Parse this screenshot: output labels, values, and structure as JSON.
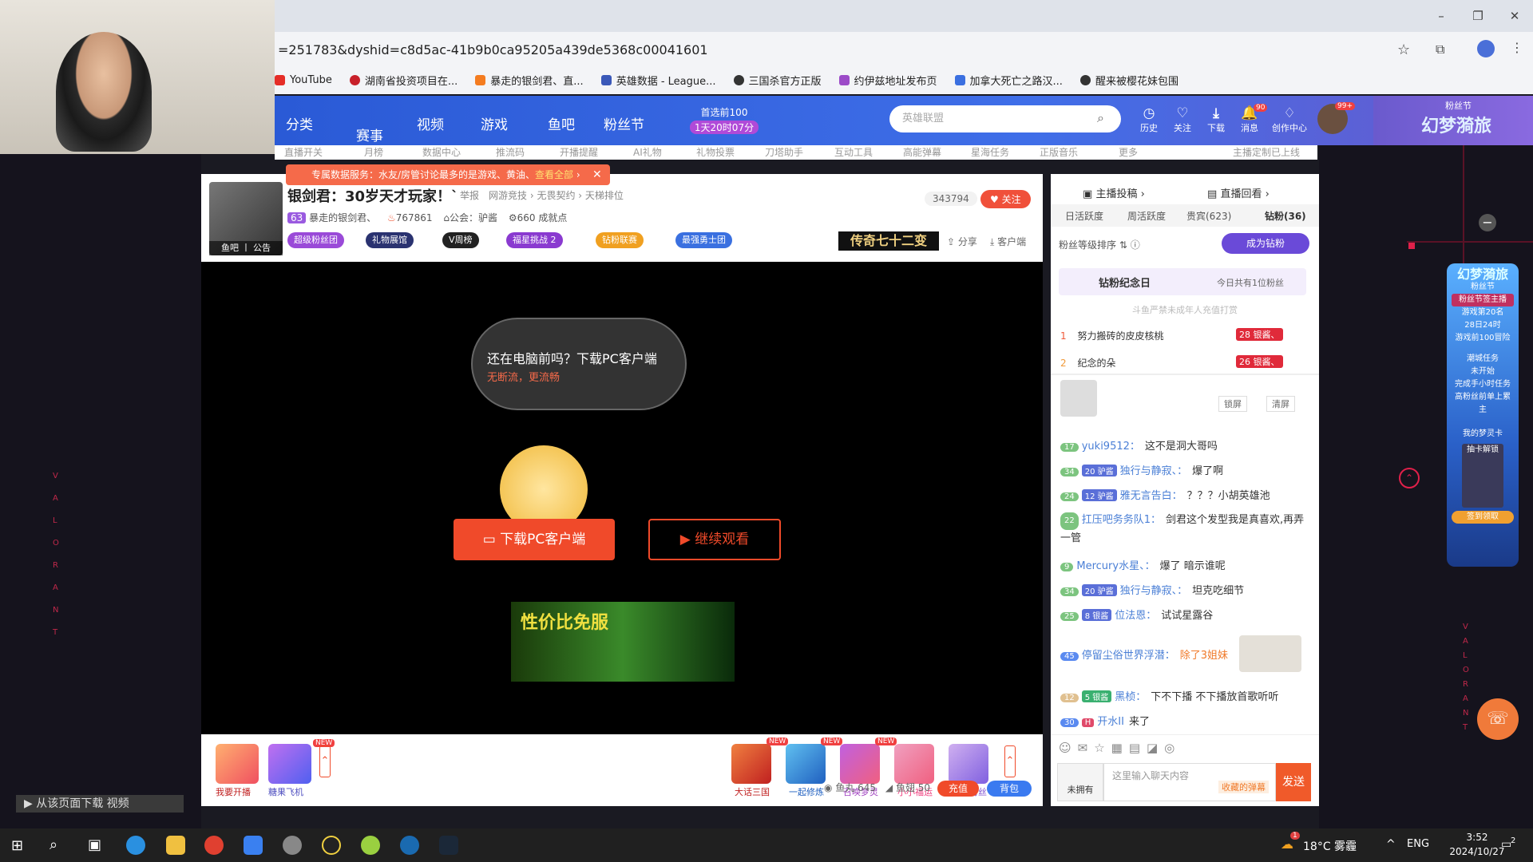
{
  "browser": {
    "url": "=251783&dyshid=c8d5ac-41b9b0ca95205a439de5368c00041601",
    "bookmarks": [
      "YouTube",
      "湖南省投资项目在...",
      "暴走的银剑君、直...",
      "英雄数据 - League...",
      "三国杀官方正版",
      "约伊兹地址发布页",
      "加拿大死亡之路汉...",
      "醒来被樱花妹包围"
    ]
  },
  "site": {
    "nav": [
      "分类",
      "赛事",
      "视频",
      "游戏",
      "鱼吧",
      "粉丝节"
    ],
    "promo_top": "首选前100",
    "promo_timer": "1天20时07分",
    "search_placeholder": "英雄联盟",
    "header_icons": [
      "历史",
      "关注",
      "下载",
      "消息",
      "创作中心"
    ],
    "msg_count": "90",
    "avatar_badge": "99+",
    "banner_text": "幻梦漪旅",
    "banner_sub": "粉丝节",
    "subnav": [
      "直播开关",
      "月榜",
      "数据中心",
      "推流码",
      "开播提醒",
      "AI礼物",
      "礼物投票",
      "刀塔助手",
      "互动工具",
      "高能弹幕",
      "星海任务",
      "正版音乐",
      "更多",
      "主播定制已上线"
    ]
  },
  "notice": {
    "text": "专属数据服务：水友/房管讨论最多的是游戏、黄油、",
    "link": "查看全部"
  },
  "room": {
    "title": "银剑君：30岁天才玩家！`",
    "report": "举报",
    "category": "网游竞技",
    "category2": "无畏契约",
    "category3": "天梯排位",
    "level": "63",
    "streamer": "暴走的银剑君、",
    "hot": "767861",
    "guild": "公会：驴酱",
    "achieve": "660 成就点",
    "followers": "343794",
    "follow": "关注",
    "share": "分享",
    "client": "客户端",
    "avatar_label": "鱼吧 丨 公告",
    "badges": [
      "超级粉丝团",
      "礼物展馆",
      "V周榜",
      "福星挑战 2",
      "钻粉联赛",
      "最强勇士团"
    ],
    "ad_title": "传奇七十二变"
  },
  "player": {
    "bubble_line1": "还在电脑前吗？下载PC客户端",
    "bubble_line2": "无断流，更流畅",
    "download_btn": "下载PC客户端",
    "continue_btn": "继续观看",
    "ad_text": "性价比免服"
  },
  "giftbar": {
    "left": [
      "我要开播",
      "糖果飞机"
    ],
    "right": [
      "大话三国",
      "一起修炼",
      "召唤梦灵",
      "小小福运",
      "钻石粉丝"
    ],
    "fish_ball": "鱼丸 645",
    "fish_fin": "鱼翅 50",
    "recharge": "充值",
    "bag": "背包",
    "new_tag": "NEW"
  },
  "rpanel": {
    "top_links": [
      "主播投稿",
      "直播回看"
    ],
    "tabs": [
      "日活跃度",
      "周活跃度",
      "贵宾(623)",
      "钻粉(36)"
    ],
    "sort_label": "粉丝等级排序",
    "become_btn": "成为钻粉",
    "anniv_title": "钻粉纪念日",
    "anniv_sub": "今日共有1位粉丝",
    "minor_notice": "斗鱼严禁未成年人充值打赏",
    "ranks": [
      {
        "no": "1",
        "name": "努力搬砖的皮皮核桃",
        "lv": "28",
        "tag": "银酱、"
      },
      {
        "no": "2",
        "name": "纪念的朵",
        "lv": "26",
        "tag": "银酱、"
      }
    ],
    "lock": "锁屏",
    "clear": "清屏",
    "chats": [
      {
        "lv": "17",
        "fan": "",
        "name": "yuki9512：",
        "msg": "这不是洞大哥吗"
      },
      {
        "lv": "34",
        "fan": "20 驴酱",
        "name": "独行与静寂、：",
        "msg": "爆了啊"
      },
      {
        "lv": "24",
        "fan": "12 驴酱",
        "name": "雅无言告白：",
        "msg": "？？？小胡英雄池"
      },
      {
        "lv": "22",
        "fan": "",
        "name": "扛压吧务务队1：",
        "msg": "剑君这个发型我是真喜欢,再弄一管"
      },
      {
        "lv": "9",
        "fan": "",
        "name": "Mercury水星、：",
        "msg": "爆了 暗示谁呢"
      },
      {
        "lv": "34",
        "fan": "20 驴酱",
        "name": "独行与静寂、：",
        "msg": "坦克吃细节"
      },
      {
        "lv": "25",
        "fan": "8 银酱",
        "name": "位法恩：",
        "msg": "试试星露谷"
      },
      {
        "lv": "45",
        "fan": "",
        "name": "停留尘俗世界浮潜：",
        "msg": "除了3姐妹"
      },
      {
        "lv": "12",
        "fan": "5 银酱",
        "name": "黑桢：",
        "msg": "下不下播 不下播放首歌听听"
      },
      {
        "lv": "30",
        "fan": "H",
        "name": "开水II",
        "msg": "来了"
      }
    ],
    "input_placeholder": "这里输入聊天内容",
    "collect": "收藏的弹幕",
    "send": "发送",
    "not_owned": "未拥有"
  },
  "side_banner": {
    "title": "幻梦漪旅",
    "items": [
      "粉丝节",
      "粉丝节签主播",
      "游戏第20名",
      "28日24时",
      "游戏前100冒险",
      "潮城任务",
      "未开始",
      "完成手小时任务",
      "高粉丝前单上累主",
      "我的梦灵卡",
      "抽卡解锁",
      "签到领取"
    ]
  },
  "overlay_text": "从该页面下载 视频",
  "taskbar": {
    "weather": "18°C 雾霾",
    "lang": "ENG",
    "time": "3:52",
    "date": "2024/10/27",
    "badge": "1",
    "notif": "2"
  }
}
